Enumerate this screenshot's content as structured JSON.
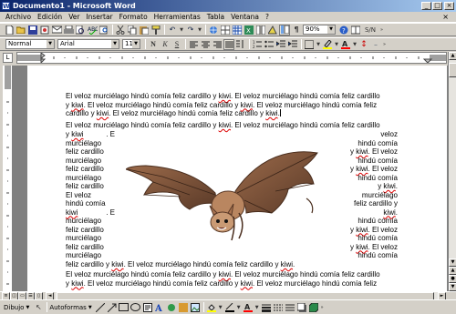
{
  "title": "Documento1 - Microsoft Word",
  "window_buttons": [
    "_",
    "□",
    "×"
  ],
  "menu": [
    "Archivo",
    "Edición",
    "Ver",
    "Insertar",
    "Formato",
    "Herramientas",
    "Tabla",
    "Ventana",
    "?"
  ],
  "ask": "×",
  "standard": {
    "zoom": "90%",
    "sim": "S/N"
  },
  "formatting": {
    "style": "Normal",
    "font": "Arial",
    "size": "11"
  },
  "drawing": {
    "dibujo": "Dibujo",
    "autoformas": "Autoformas"
  },
  "doc": {
    "para1": [
      [
        "El veloz murciélago hindú comía feliz cardillo y ",
        "kiwi",
        ". El veloz murciélago hindú comía feliz cardillo"
      ],
      [
        "y ",
        "kiwi",
        ". El veloz murciélago hindú comía feliz cardillo y ",
        "kiwi",
        ". El veloz murciélago hindú comía feliz"
      ],
      [
        "cardillo y ",
        "kiwi",
        ". El veloz murciélago hindú comía feliz cardillo y ",
        "kiwi",
        "."
      ]
    ],
    "para2": [
      "El veloz murciélago hindú comía feliz cardillo y ",
      "kiwi",
      ". El veloz murciélago hindú comía feliz cardillo"
    ],
    "left": [
      [
        "y ",
        "kiwi",
        ". E"
      ],
      [
        "murciélago"
      ],
      [
        "feliz cardillo"
      ],
      [
        "murciélago"
      ],
      [
        "feliz cardillo"
      ],
      [
        "murciélago"
      ],
      [
        "feliz cardillo"
      ],
      [
        "El veloz"
      ],
      [
        "hindú comía"
      ],
      [
        "kiwi",
        ". E"
      ],
      [
        "murciélago"
      ],
      [
        "feliz cardillo"
      ],
      [
        "murciélago"
      ],
      [
        "feliz cardillo"
      ],
      [
        "murciélago"
      ]
    ],
    "right": [
      [
        "veloz"
      ],
      [
        "hindú comía"
      ],
      [
        "y ",
        "kiwi",
        ". El veloz"
      ],
      [
        "hindú comía"
      ],
      [
        "y ",
        "kiwi",
        ". El veloz"
      ],
      [
        "hindú comía"
      ],
      [
        "y ",
        "kiwi",
        "."
      ],
      [
        "murciélago"
      ],
      [
        "feliz cardillo y"
      ],
      [
        "kiwi",
        "."
      ],
      [
        "hindú comía"
      ],
      [
        "y ",
        "kiwi",
        ". El veloz"
      ],
      [
        "hindú comía"
      ],
      [
        "y ",
        "kiwi",
        ". El veloz"
      ],
      [
        "hindú comía"
      ]
    ],
    "after_wrap": [
      "feliz cardillo y ",
      "kiwi",
      ".  El veloz murciélago hindú comía feliz cardillo y ",
      "kiwi",
      "."
    ],
    "para3": [
      [
        "El veloz murciélago hindú comía feliz cardillo y ",
        "kiwi",
        ". El veloz murciélago hindú comía feliz cardillo"
      ],
      [
        "y ",
        "kiwi",
        ". El veloz murciélago hindú comía feliz cardillo y ",
        "kiwi",
        ". El veloz murciélago hindú comía feliz"
      ]
    ],
    "spell_word": "kiwi"
  },
  "colors": {
    "titlebar_start": "#0a246a",
    "titlebar_end": "#a6caf0",
    "spell_underline": "#dd0000",
    "highlight": "#ffff00",
    "font_color": "#ff0000"
  },
  "icons": [
    "new-icon",
    "open-icon",
    "save-icon",
    "permission-icon",
    "email-icon",
    "print-icon",
    "print-preview-icon",
    "spelling-icon",
    "research-icon",
    "cut-icon",
    "copy-icon",
    "paste-icon",
    "format-painter-icon",
    "undo-icon",
    "redo-icon",
    "hyperlink-icon",
    "tables-borders-icon",
    "insert-table-icon",
    "insert-excel-icon",
    "columns-icon",
    "drawing-icon",
    "document-map-icon",
    "show-hide-icon",
    "read-icon",
    "help-icon"
  ]
}
